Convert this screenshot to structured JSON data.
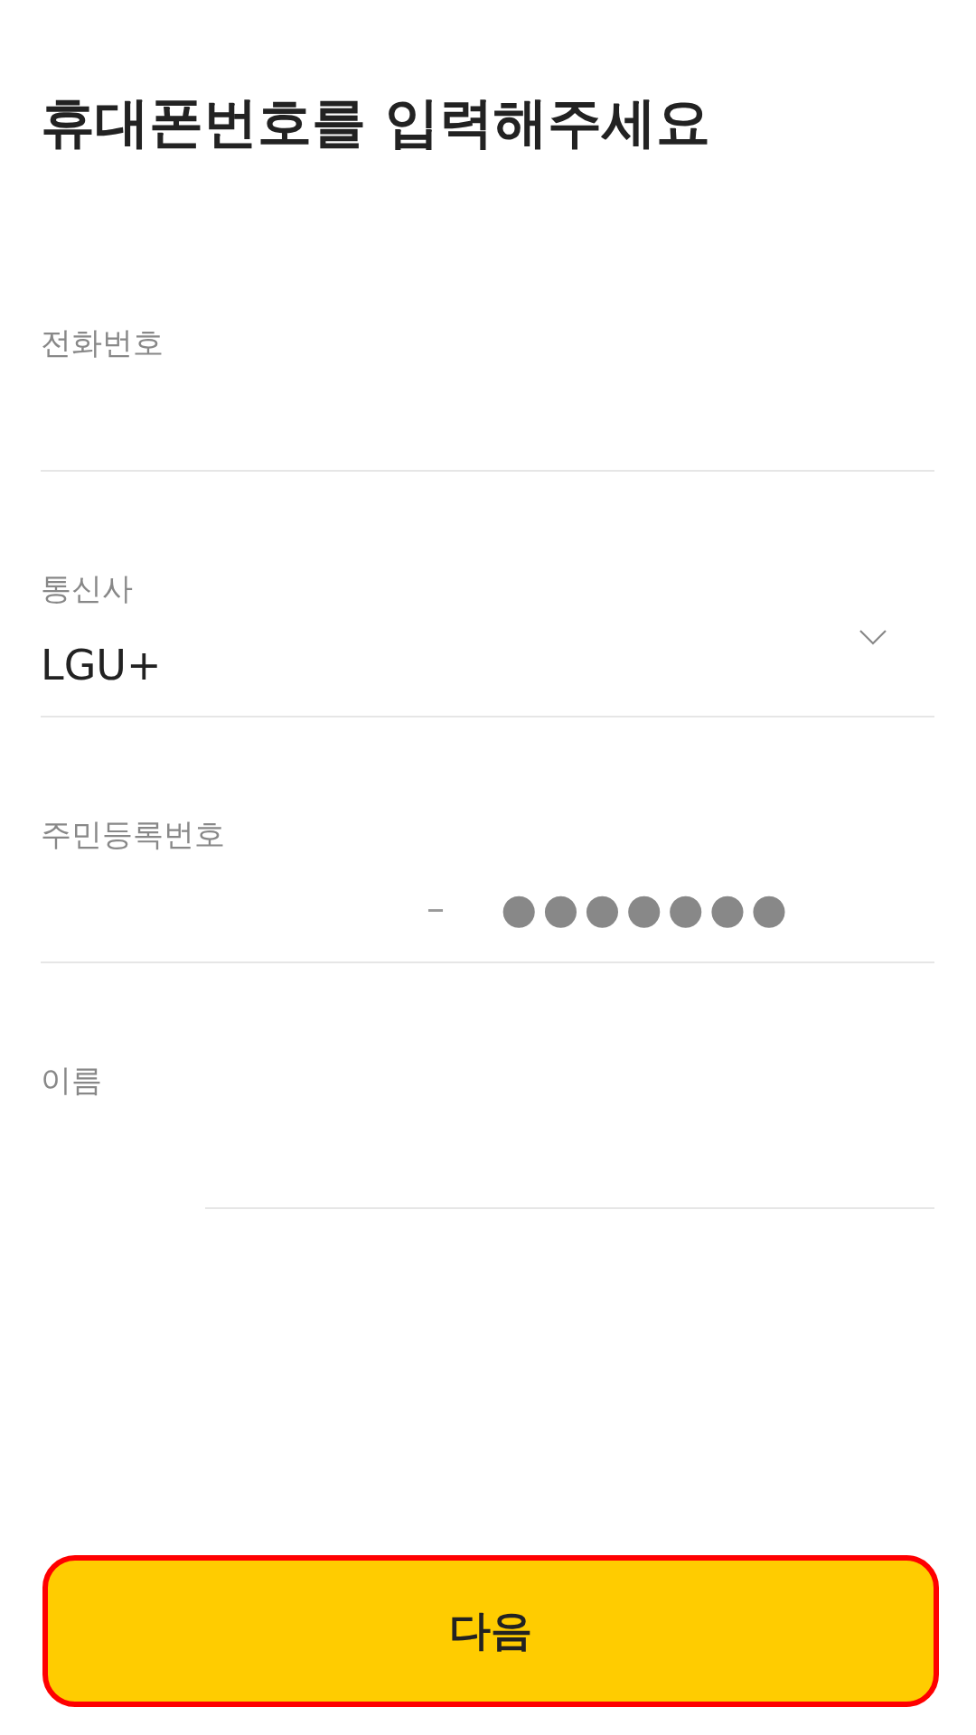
{
  "title": "휴대폰번호를 입력해주세요",
  "fields": [
    {
      "kind": "text",
      "label": "전화번호"
    },
    {
      "kind": "select",
      "label": "통신사",
      "value": "LGU+"
    },
    {
      "kind": "resident_id",
      "label": "주민등록번호",
      "separator": "–",
      "masked_value": "●●●●●●●"
    },
    {
      "kind": "text_inset",
      "label": "이름"
    }
  ],
  "next_button": {
    "label": "다음",
    "highlighted": true
  }
}
